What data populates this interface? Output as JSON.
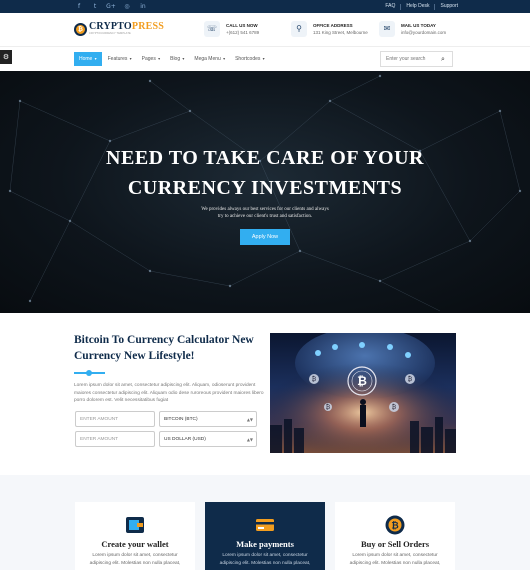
{
  "topbar": {
    "social": [
      {
        "icon": "facebook-icon",
        "glyph": "f"
      },
      {
        "icon": "twitter-icon",
        "glyph": "t"
      },
      {
        "icon": "google-plus-icon",
        "glyph": "G+"
      },
      {
        "icon": "instagram-icon",
        "glyph": "◎"
      },
      {
        "icon": "linkedin-icon",
        "glyph": "in"
      }
    ],
    "links": [
      "FAQ",
      "Help Desk",
      "Support"
    ]
  },
  "header": {
    "logo_part1": "CRYPTO",
    "logo_part2": "PRESS",
    "logo_tagline": "CRYPTOCURRENCY TEMPLATE",
    "logo_mark": "₿",
    "contacts": [
      {
        "icon": "phone-icon",
        "glyph": "☏",
        "label": "CALL US NOW",
        "value": "+(612) 541 6789"
      },
      {
        "icon": "location-pin-icon",
        "glyph": "⚲",
        "label": "OFFICE ADDRESS",
        "value": "131 King Street, Melbourne"
      },
      {
        "icon": "mail-icon",
        "glyph": "✉",
        "label": "MAIL US TODAY",
        "value": "info@yourdomain.com"
      }
    ]
  },
  "nav": {
    "items": [
      {
        "label": "Home",
        "active": true
      },
      {
        "label": "Features",
        "active": false
      },
      {
        "label": "Pages",
        "active": false
      },
      {
        "label": "Blog",
        "active": false
      },
      {
        "label": "Mega Menu",
        "active": false
      },
      {
        "label": "Shortcodes",
        "active": false
      }
    ],
    "search_placeholder": "Enter your search"
  },
  "hero": {
    "title_line1": "NEED TO TAKE CARE OF YOUR",
    "title_line2": "CURRENCY INVESTMENTS",
    "subtitle_line1": "We provides always our best services for our clients and always",
    "subtitle_line2": "try to achieve our client's trust and satisfaction.",
    "button": "Apply Now"
  },
  "calculator": {
    "title": "Bitcoin To Currency Calculator New Currency New Lifestyle!",
    "text": "Lorem ipsum dolor sit amet, consectetur adipiscing elit. Aliquam, odioserunt provident maiores consectetur adipiscing elit. Aliquam odio dese ruroreous provident maiores libero porro dolorem est. Velit necessitatibus fugiat",
    "amount_placeholder_1": "ENTER AMOUNT",
    "currency_1": "BITCOIN (BTC)",
    "amount_placeholder_2": "ENTER AMOUNT",
    "currency_2": "US DOLLAR (USD)"
  },
  "features": [
    {
      "icon": "wallet-icon",
      "title": "Create your wallet",
      "text": "Lorem ipsum dolor sit amet, consectetur adipiscing elit. Molestias non nulla placeat,",
      "dark": false
    },
    {
      "icon": "credit-card-icon",
      "title": "Make payments",
      "text": "Lorem ipsum dolor sit amet, consectetur adipiscing elit. Molestias non nulla placeat,",
      "dark": true
    },
    {
      "icon": "bitcoin-coin-icon",
      "title": "Buy or Sell Orders",
      "text": "Lorem ipsum dolor sit amet, consectetur adipiscing elit. Molestias non nulla placeat,",
      "dark": false
    }
  ],
  "colors": {
    "navy": "#0f2b4a",
    "accent": "#32aef0",
    "orange": "#f29d1f"
  }
}
